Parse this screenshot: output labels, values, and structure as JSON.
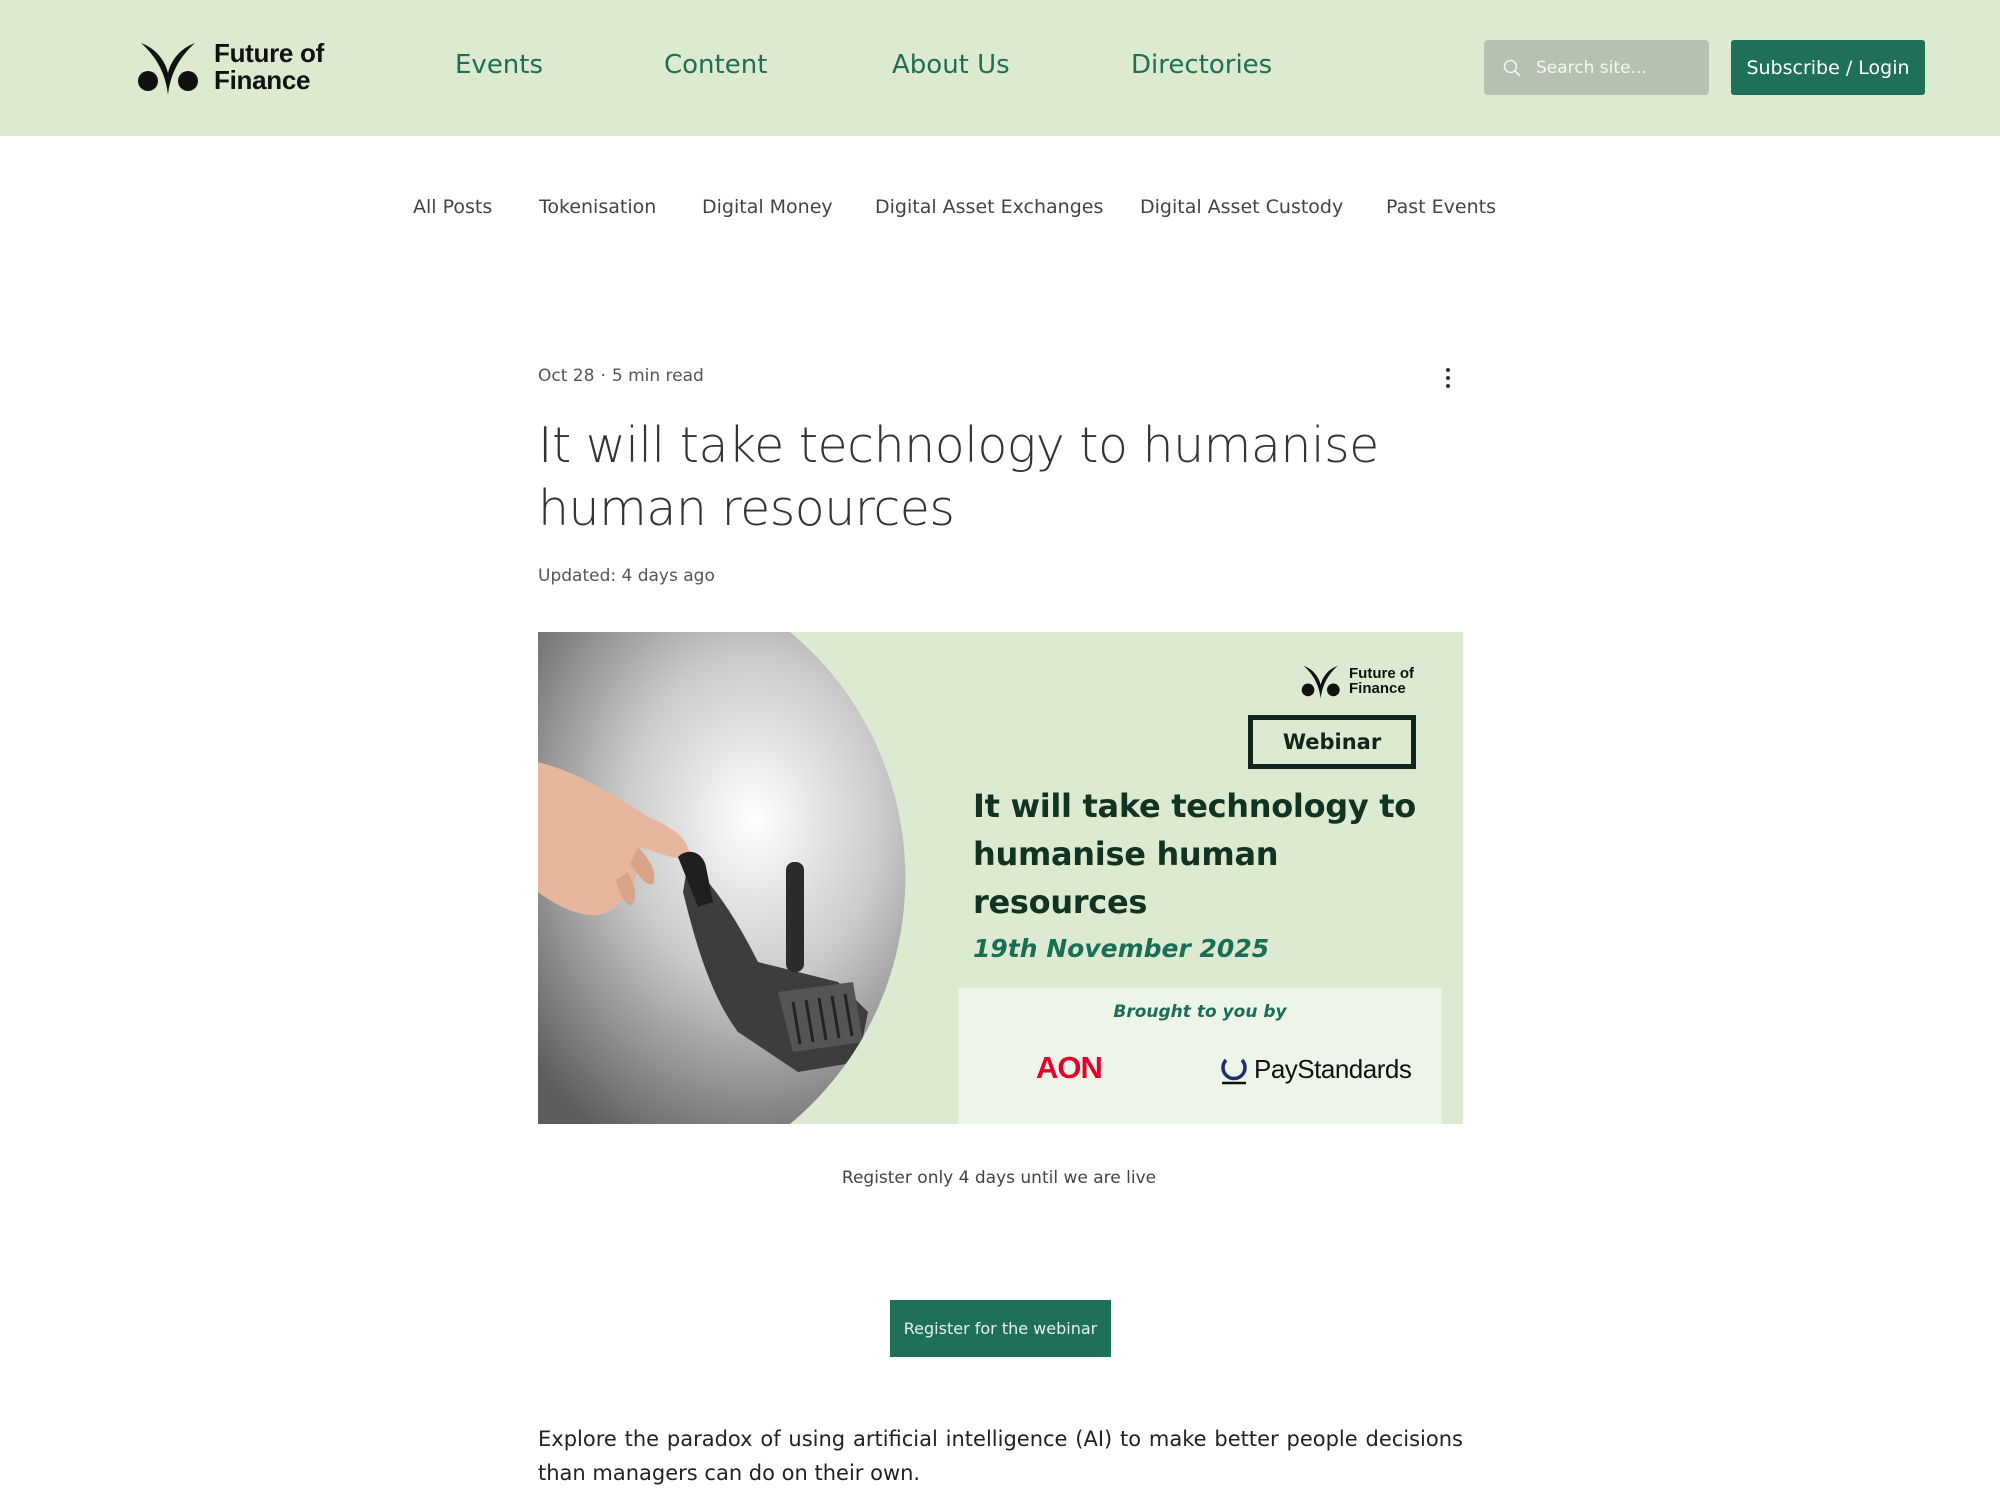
{
  "header": {
    "brand": "Future of Finance",
    "brand_line1": "Future of",
    "brand_line2": "Finance",
    "nav": [
      "Events",
      "Content",
      "About Us",
      "Directories"
    ],
    "search_placeholder": "Search site...",
    "subscribe_label": "Subscribe / Login"
  },
  "categories": [
    "All Posts",
    "Tokenisation",
    "Digital Money",
    "Digital Asset Exchanges",
    "Digital Asset Custody",
    "Past Events"
  ],
  "post": {
    "date": "Oct 28",
    "separator": "·",
    "read_time": "5 min read",
    "title": "It will take technology to humanise human resources",
    "updated": "Updated: 4 days ago"
  },
  "banner": {
    "logo_line1": "Future of",
    "logo_line2": "Finance",
    "tag": "Webinar",
    "title": "It will take technology to humanise human resources",
    "date": "19th November 2025",
    "brought_by": "Brought to you by",
    "sponsor1": "AON",
    "sponsor2": "PayStandards"
  },
  "register_note": "Register only 4 days until we are live",
  "register_button": "Register for the webinar",
  "intro": "Explore the paradox of using artificial intelligence (AI) to make better people decisions than managers can do on their own.",
  "colors": {
    "header_bg": "#dceacf",
    "accent": "#1e7059",
    "nav_text": "#1f6e56",
    "aon_red": "#e4002b"
  }
}
